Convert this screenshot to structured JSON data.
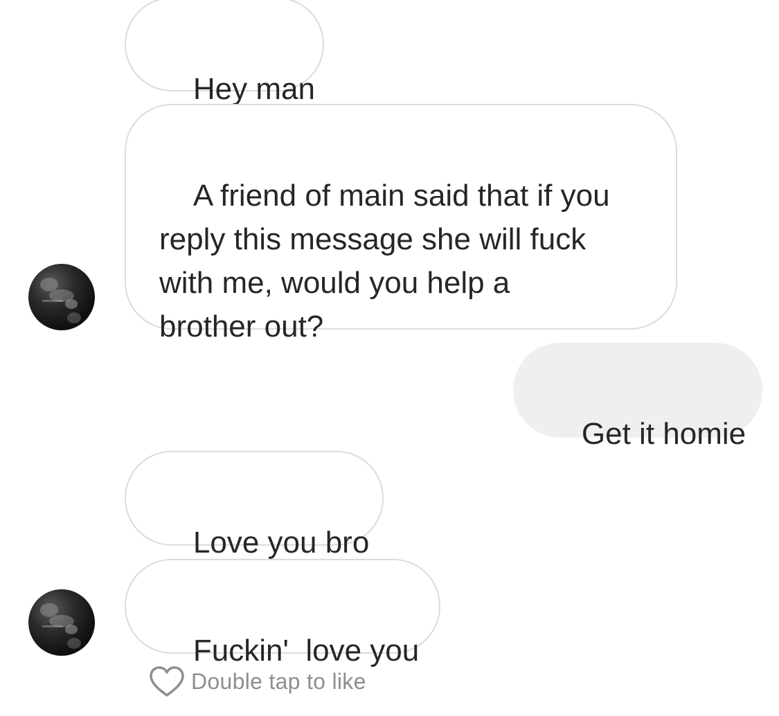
{
  "thread": {
    "messages": [
      {
        "direction": "incoming",
        "text": "Hey man"
      },
      {
        "direction": "incoming",
        "text": "A friend of main said that if you\nreply this message she will fuck\nwith me, would you help a\nbrother out?"
      },
      {
        "direction": "outgoing",
        "text": "Get it homie"
      },
      {
        "direction": "incoming",
        "text": "Love you bro"
      },
      {
        "direction": "incoming",
        "text": "Fuckin'  love you"
      }
    ],
    "like_hint": "Double tap to like"
  },
  "colors": {
    "incoming_border": "#dbdbdb",
    "outgoing_bg": "#efefef",
    "text": "#262626",
    "hint_text": "#8e8e8e"
  },
  "icons": {
    "avatar": "profile-photo",
    "like": "heart-outline-icon"
  }
}
